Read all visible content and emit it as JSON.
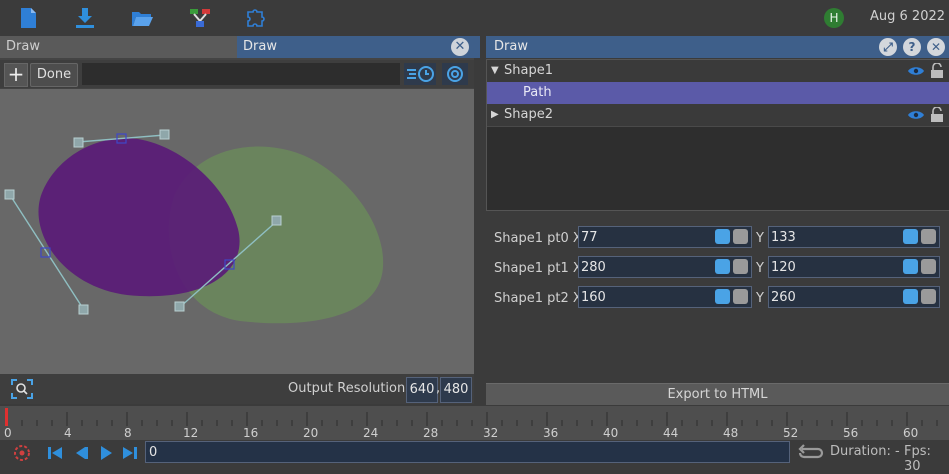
{
  "topbar": {
    "icons": [
      "new-file-icon",
      "download-icon",
      "open-folder-icon",
      "node-graph-icon",
      "puzzle-icon"
    ],
    "avatar_letter": "H",
    "date": "Aug  6 2022"
  },
  "left_panel": {
    "tabs": [
      "Draw",
      "Draw"
    ],
    "done_label": "Done",
    "output_resolution_label": "Output Resolution:",
    "resolution_width": "640",
    "resolution_sep": ",",
    "resolution_height": "480"
  },
  "right_panel": {
    "title": "Draw",
    "tree": [
      {
        "label": "Shape1",
        "expanded": true
      },
      {
        "label": "Path",
        "selected": true
      },
      {
        "label": "Shape2",
        "expanded": false
      }
    ],
    "props": [
      {
        "label": "Shape1 pt0 X",
        "x": "77",
        "y_label": "Y",
        "y": "133"
      },
      {
        "label": "Shape1 pt1 X",
        "x": "280",
        "y_label": "Y",
        "y": "120"
      },
      {
        "label": "Shape1 pt2 X",
        "x": "160",
        "y_label": "Y",
        "y": "260"
      }
    ],
    "export_label": "Export to HTML"
  },
  "timeline": {
    "ticks": [
      "0",
      "4",
      "8",
      "12",
      "16",
      "20",
      "24",
      "28",
      "32",
      "36",
      "40",
      "44",
      "48",
      "52",
      "56",
      "60"
    ],
    "current_frame": "0",
    "duration_label": "Duration: -",
    "fps_label": "Fps: 30"
  },
  "colors": {
    "accent": "#3e5f8a",
    "selection": "#5b5aa8",
    "shape1_fill": "#5a1a78",
    "shape2_fill": "#6b8a5c"
  }
}
